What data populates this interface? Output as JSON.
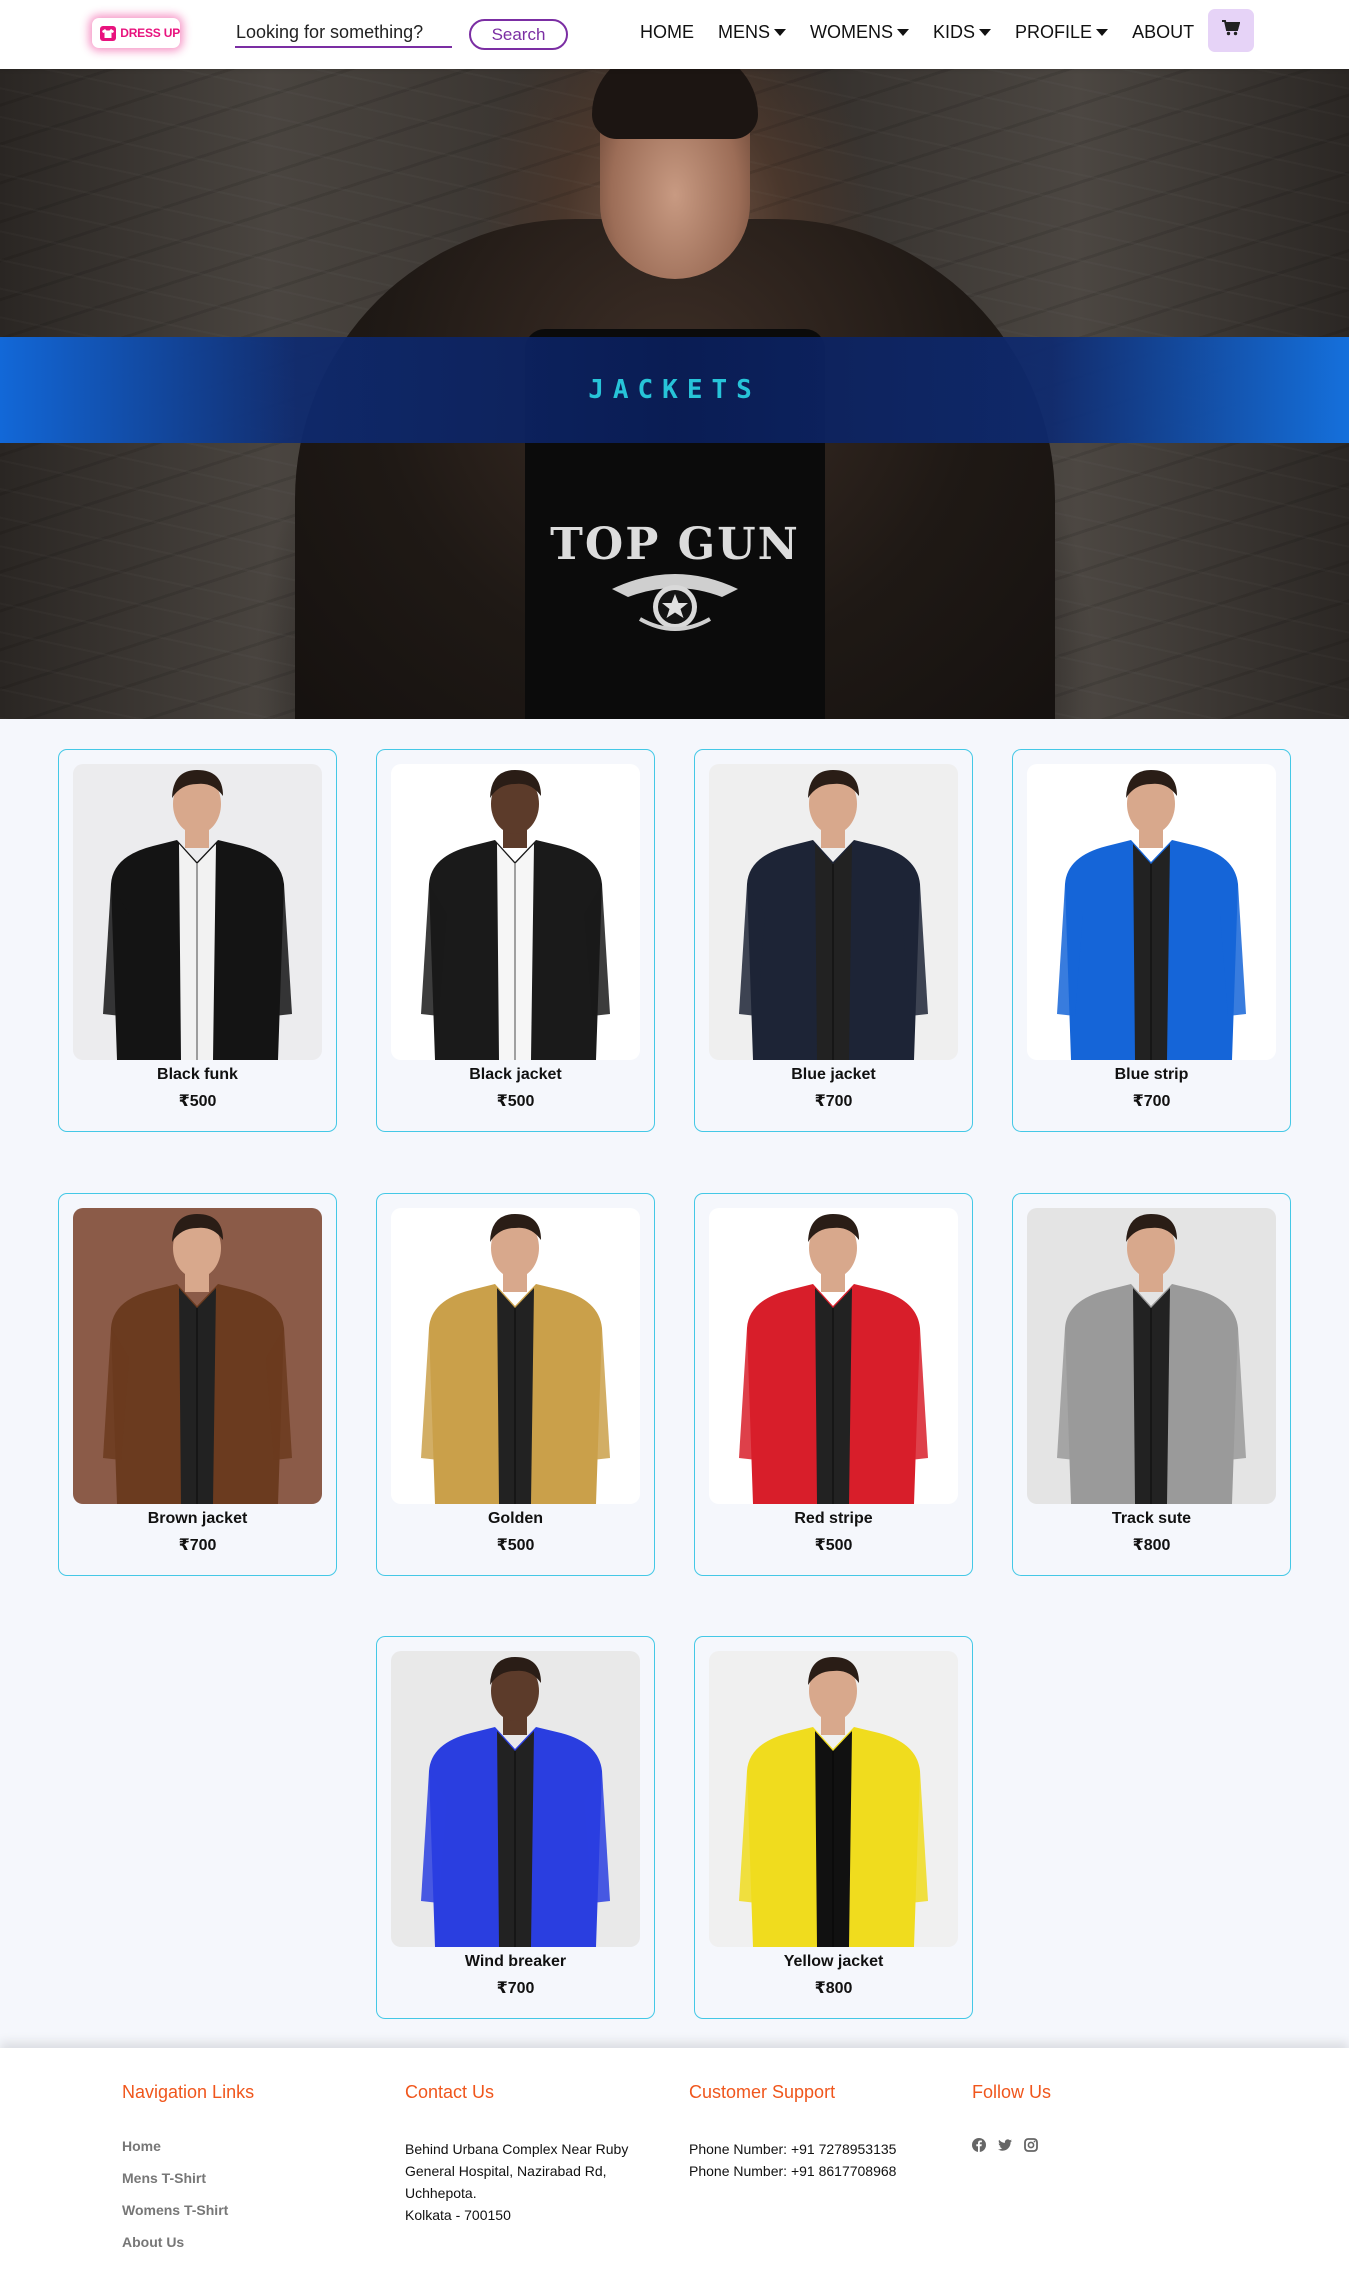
{
  "navbar": {
    "logo_text": "DRESS UP",
    "search_placeholder": "Looking for something?",
    "search_button": "Search",
    "links": [
      {
        "label": "HOME",
        "dropdown": false
      },
      {
        "label": "MENS",
        "dropdown": true
      },
      {
        "label": "WOMENS",
        "dropdown": true
      },
      {
        "label": "KIDS",
        "dropdown": true
      },
      {
        "label": "PROFILE",
        "dropdown": true
      },
      {
        "label": "ABOUT",
        "dropdown": false
      }
    ],
    "cart_icon": "shopping-cart-icon"
  },
  "hero": {
    "title": "JACKETS",
    "shirt_text": "TOP GUN"
  },
  "products": [
    {
      "name": "Black funk",
      "price": "₹500",
      "jacket_color": "#141414",
      "bg": "#ececee"
    },
    {
      "name": "Black jacket",
      "price": "₹500",
      "jacket_color": "#1a1a1a",
      "bg": "#ffffff"
    },
    {
      "name": "Blue jacket",
      "price": "₹700",
      "jacket_color": "#1d2436",
      "bg": "#efefef"
    },
    {
      "name": "Blue strip",
      "price": "₹700",
      "jacket_color": "#1565d8",
      "bg": "#ffffff"
    },
    {
      "name": "Brown jacket",
      "price": "₹700",
      "jacket_color": "#6b3b1f",
      "bg": "#8b5b48"
    },
    {
      "name": "Golden",
      "price": "₹500",
      "jacket_color": "#caa04a",
      "bg": "#ffffff"
    },
    {
      "name": "Red stripe",
      "price": "₹500",
      "jacket_color": "#d81e2a",
      "bg": "#ffffff"
    },
    {
      "name": "Track sute",
      "price": "₹800",
      "jacket_color": "#9a9a9a",
      "bg": "#e4e4e4"
    },
    {
      "name": "Wind breaker",
      "price": "₹700",
      "jacket_color": "#2a3ee0",
      "bg": "#e9e9e9"
    },
    {
      "name": "Yellow jacket",
      "price": "₹800",
      "jacket_color": "#f0dc1e",
      "bg": "#f0f0f0"
    }
  ],
  "footer": {
    "nav": {
      "heading": "Navigation Links",
      "links": [
        "Home",
        "Mens T-Shirt",
        "Womens T-Shirt",
        "About Us"
      ]
    },
    "contact": {
      "heading": "Contact Us",
      "lines": [
        "Behind Urbana Complex Near Ruby",
        "General Hospital, Nazirabad Rd,",
        "Uchhepota.",
        "Kolkata - 700150"
      ]
    },
    "support": {
      "heading": "Customer Support",
      "lines": [
        "Phone Number: +91 7278953135",
        "Phone Number: +91 8617708968"
      ]
    },
    "follow": {
      "heading": "Follow Us",
      "icons": [
        "facebook-icon",
        "twitter-icon",
        "instagram-icon"
      ]
    }
  },
  "colors": {
    "accent": "#7b2ea3",
    "brand_pink": "#e8137e",
    "card_border": "#44c8e6",
    "footer_heading": "#f0561c",
    "hero_title": "#27c4d8"
  }
}
